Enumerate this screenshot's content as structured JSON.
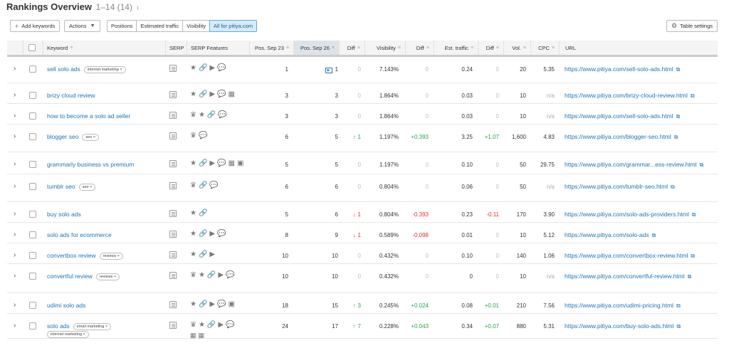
{
  "header": {
    "title": "Rankings Overview",
    "range": "1–14 (14)",
    "info_icon": "i"
  },
  "toolbar": {
    "add_keywords": "Add keywords",
    "actions": "Actions",
    "tabs": [
      "Positions",
      "Estimated traffic",
      "Visibility",
      "All for pitiya.com"
    ],
    "table_settings": "Table settings"
  },
  "columns": {
    "keyword": "Keyword",
    "serp": "SERP",
    "serp_features": "SERP Features",
    "pos_sep23": "Pos. Sep 23",
    "pos_sep26": "Pos. Sep 26",
    "diff": "Diff",
    "visibility": "Visibility",
    "diff_vis": "Diff",
    "est_traffic": "Est. traffic",
    "diff_traffic": "Diff",
    "vol": "Vol.",
    "cpc": "CPC",
    "url": "URL"
  },
  "rows": [
    {
      "keyword": "sell solo ads",
      "tags": [
        "internet marketing"
      ],
      "features": "★🔗▶💬",
      "features2": "",
      "pos23": "1",
      "pos26": "1",
      "video": true,
      "diff": "0",
      "diff_dir": "",
      "visibility": "7.143%",
      "diff_vis": "0",
      "traffic": "0.24",
      "diff_traffic": "0",
      "vol": "20",
      "cpc": "5.35",
      "url": "https://www.pitiya.com/sell-solo-ads.html"
    },
    {
      "keyword": "brizy cloud review",
      "tags": [],
      "features": "★🔗▶💬▦",
      "features2": "",
      "pos23": "3",
      "pos26": "3",
      "video": false,
      "diff": "0",
      "diff_dir": "",
      "visibility": "1.864%",
      "diff_vis": "0",
      "traffic": "0.03",
      "diff_traffic": "0",
      "vol": "10",
      "cpc": "n/a",
      "url": "https://www.pitiya.com/brizy-cloud-review.html"
    },
    {
      "keyword": "how to become a solo ad seller",
      "tags": [],
      "features": "♛★🔗💬",
      "features2": "",
      "pos23": "3",
      "pos26": "3",
      "video": false,
      "diff": "0",
      "diff_dir": "",
      "visibility": "1.864%",
      "diff_vis": "0",
      "traffic": "0.03",
      "diff_traffic": "0",
      "vol": "10",
      "cpc": "n/a",
      "url": "https://www.pitiya.com/sell-solo-ads.html"
    },
    {
      "keyword": "blogger seo",
      "tags": [
        "seo"
      ],
      "features": "♛💬",
      "features2": "",
      "pos23": "6",
      "pos26": "5",
      "video": false,
      "diff": "1",
      "diff_dir": "up",
      "visibility": "1.197%",
      "diff_vis": "+0.393",
      "traffic": "3.25",
      "diff_traffic": "+1.07",
      "vol": "1,600",
      "cpc": "4.83",
      "url": "https://www.pitiya.com/blogger-seo.html"
    },
    {
      "keyword": "grammarly business vs premium",
      "tags": [],
      "features": "★🔗▶💬▦▣",
      "features2": "",
      "pos23": "5",
      "pos26": "5",
      "video": false,
      "diff": "0",
      "diff_dir": "",
      "visibility": "1.197%",
      "diff_vis": "0",
      "traffic": "0.10",
      "diff_traffic": "0",
      "vol": "50",
      "cpc": "29.75",
      "url": "https://www.pitiya.com/grammar...ess-review.html"
    },
    {
      "keyword": "tumblr seo",
      "tags": [
        "seo"
      ],
      "features": "♛🔗💬",
      "features2": "",
      "pos23": "6",
      "pos26": "6",
      "video": false,
      "diff": "0",
      "diff_dir": "",
      "visibility": "0.804%",
      "diff_vis": "0",
      "traffic": "0.06",
      "diff_traffic": "0",
      "vol": "50",
      "cpc": "n/a",
      "url": "https://www.pitiya.com/tumblr-seo.html"
    },
    {
      "keyword": "buy solo ads",
      "tags": [],
      "features": "★🔗",
      "features2": "",
      "pos23": "5",
      "pos26": "6",
      "video": false,
      "diff": "1",
      "diff_dir": "down",
      "visibility": "0.804%",
      "diff_vis": "-0.393",
      "traffic": "0.23",
      "diff_traffic": "-0.11",
      "vol": "170",
      "cpc": "3.90",
      "url": "https://www.pitiya.com/solo-ads-providers.html"
    },
    {
      "keyword": "solo ads for ecommerce",
      "tags": [],
      "features": "★🔗▶💬",
      "features2": "",
      "pos23": "8",
      "pos26": "9",
      "video": false,
      "diff": "1",
      "diff_dir": "down",
      "visibility": "0.589%",
      "diff_vis": "-0.098",
      "traffic": "0.01",
      "diff_traffic": "0",
      "vol": "10",
      "cpc": "5.12",
      "url": "https://www.pitiya.com/solo-ads"
    },
    {
      "keyword": "convertbox review",
      "tags": [
        "reviews"
      ],
      "features": "★🔗▶",
      "features2": "",
      "pos23": "10",
      "pos26": "10",
      "video": false,
      "diff": "0",
      "diff_dir": "",
      "visibility": "0.432%",
      "diff_vis": "0",
      "traffic": "0.10",
      "diff_traffic": "0",
      "vol": "140",
      "cpc": "1.06",
      "url": "https://www.pitiya.com/convertbox-review.html"
    },
    {
      "keyword": "convertful review",
      "tags": [
        "reviews"
      ],
      "features": "♛★🔗▶💬",
      "features2": "",
      "pos23": "10",
      "pos26": "10",
      "video": false,
      "diff": "0",
      "diff_dir": "",
      "visibility": "0.432%",
      "diff_vis": "0",
      "traffic": "0",
      "diff_traffic": "0",
      "vol": "10",
      "cpc": "n/a",
      "url": "https://www.pitiya.com/convertful-review.html"
    },
    {
      "keyword": "udimi solo ads",
      "tags": [],
      "features": "★🔗▶💬▣",
      "features2": "",
      "pos23": "18",
      "pos26": "15",
      "video": false,
      "diff": "3",
      "diff_dir": "up",
      "visibility": "0.245%",
      "diff_vis": "+0.024",
      "traffic": "0.08",
      "diff_traffic": "+0.01",
      "vol": "210",
      "cpc": "7.56",
      "url": "https://www.pitiya.com/udimi-pricing.html"
    },
    {
      "keyword": "solo ads",
      "tags": [
        "email marketing",
        "internet marketing"
      ],
      "features": "♛★🔗▶💬",
      "features2": "▦▦",
      "pos23": "24",
      "pos26": "17",
      "video": false,
      "diff": "7",
      "diff_dir": "up",
      "visibility": "0.228%",
      "diff_vis": "+0.043",
      "traffic": "0.34",
      "diff_traffic": "+0.07",
      "vol": "880",
      "cpc": "5.31",
      "url": "https://www.pitiya.com/buy-solo-ads.html"
    }
  ],
  "colors": {
    "link": "#1a75bb",
    "up": "#2ba14c",
    "down": "#e0312e",
    "active_tab": "#d4ebfb"
  }
}
